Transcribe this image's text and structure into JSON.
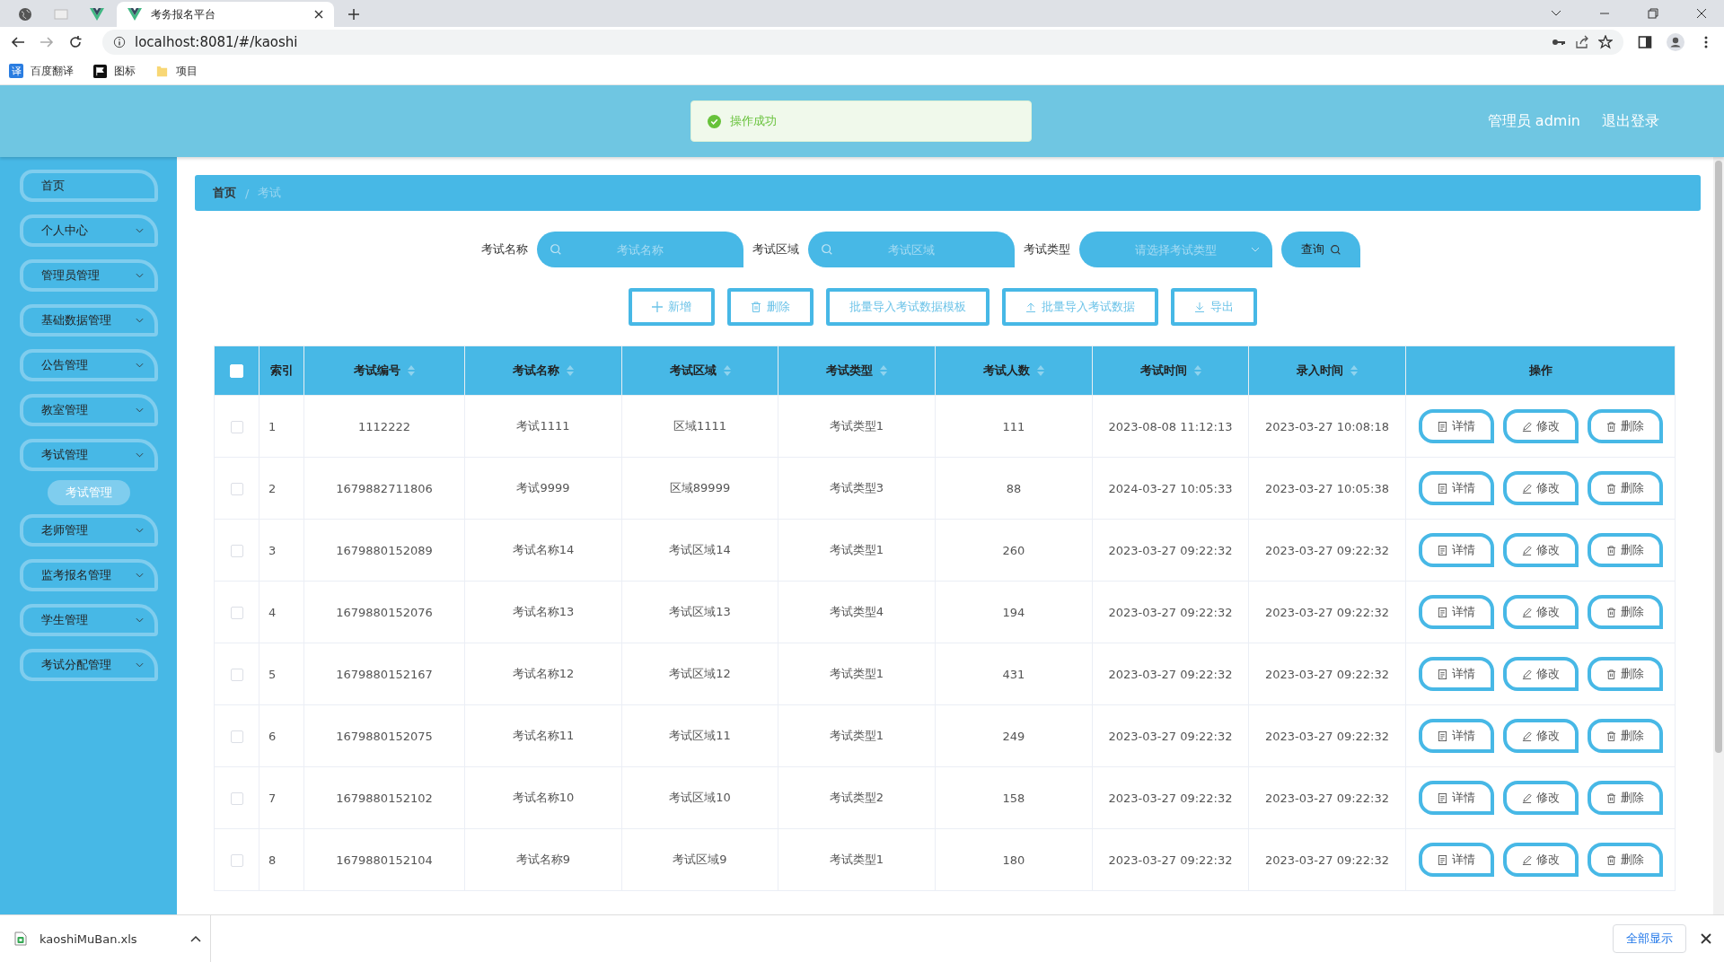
{
  "browser": {
    "tabs": [
      {
        "kind": "globe",
        "selected": false
      },
      {
        "kind": "blank",
        "selected": false
      },
      {
        "kind": "vue",
        "selected": false
      },
      {
        "kind": "vue",
        "title": "考务报名平台",
        "selected": true
      }
    ],
    "address": "localhost:8081/#/kaoshi",
    "bookmarks": [
      {
        "kind": "translate",
        "label": "百度翻译",
        "badge": "译"
      },
      {
        "kind": "flag",
        "label": "图标"
      },
      {
        "kind": "folder",
        "label": "项目"
      }
    ]
  },
  "header": {
    "toast": "操作成功",
    "user": "管理员 admin",
    "logout": "退出登录"
  },
  "sidebar": {
    "items": [
      {
        "label": "首页",
        "kind": "link"
      },
      {
        "label": "个人中心",
        "kind": "menu"
      },
      {
        "label": "管理员管理",
        "kind": "menu"
      },
      {
        "label": "基础数据管理",
        "kind": "menu"
      },
      {
        "label": "公告管理",
        "kind": "menu"
      },
      {
        "label": "教室管理",
        "kind": "menu"
      },
      {
        "label": "考试管理",
        "kind": "menu",
        "children": [
          {
            "label": "考试管理",
            "selected": true
          }
        ]
      },
      {
        "label": "老师管理",
        "kind": "menu"
      },
      {
        "label": "监考报名管理",
        "kind": "menu"
      },
      {
        "label": "学生管理",
        "kind": "menu"
      },
      {
        "label": "考试分配管理",
        "kind": "menu"
      }
    ]
  },
  "breadcrumb": [
    "首页",
    "考试"
  ],
  "breadcrumb_separator": "/",
  "filters": [
    {
      "label": "考试名称",
      "kind": "text",
      "placeholder": "考试名称"
    },
    {
      "label": "考试区域",
      "kind": "text",
      "placeholder": "考试区域"
    },
    {
      "label": "考试类型",
      "kind": "select",
      "placeholder": "请选择考试类型"
    }
  ],
  "search_button": "查询",
  "actions": [
    {
      "kind": "add",
      "label": "新增"
    },
    {
      "kind": "delete",
      "label": "删除"
    },
    {
      "kind": "none",
      "label": "批量导入考试数据模板"
    },
    {
      "kind": "upload",
      "label": "批量导入考试数据"
    },
    {
      "kind": "download",
      "label": "导出"
    }
  ],
  "table": {
    "columns": [
      {
        "label": "索引",
        "sortable": false
      },
      {
        "label": "考试编号",
        "sortable": true
      },
      {
        "label": "考试名称",
        "sortable": true
      },
      {
        "label": "考试区域",
        "sortable": true
      },
      {
        "label": "考试类型",
        "sortable": true
      },
      {
        "label": "考试人数",
        "sortable": true
      },
      {
        "label": "考试时间",
        "sortable": true
      },
      {
        "label": "录入时间",
        "sortable": true
      },
      {
        "label": "操作",
        "sortable": false
      }
    ],
    "header_checked": false,
    "rows": [
      {
        "checked": false,
        "cells": [
          "1",
          "1112222",
          "考试1111",
          "区域1111",
          "考试类型1",
          "111",
          "2023-08-08 11:12:13",
          "2023-03-27 10:08:18"
        ],
        "actions": [
          {
            "kind": "detail",
            "label": "详情"
          },
          {
            "kind": "edit",
            "label": "修改"
          },
          {
            "kind": "delete",
            "label": "删除"
          }
        ]
      },
      {
        "checked": false,
        "cells": [
          "2",
          "1679882711806",
          "考试9999",
          "区域89999",
          "考试类型3",
          "88",
          "2024-03-27 10:05:33",
          "2023-03-27 10:05:38"
        ],
        "actions": [
          {
            "kind": "detail",
            "label": "详情"
          },
          {
            "kind": "edit",
            "label": "修改"
          },
          {
            "kind": "delete",
            "label": "删除"
          }
        ]
      },
      {
        "checked": false,
        "cells": [
          "3",
          "1679880152089",
          "考试名称14",
          "考试区域14",
          "考试类型1",
          "260",
          "2023-03-27 09:22:32",
          "2023-03-27 09:22:32"
        ],
        "actions": [
          {
            "kind": "detail",
            "label": "详情"
          },
          {
            "kind": "edit",
            "label": "修改"
          },
          {
            "kind": "delete",
            "label": "删除"
          }
        ]
      },
      {
        "checked": false,
        "cells": [
          "4",
          "1679880152076",
          "考试名称13",
          "考试区域13",
          "考试类型4",
          "194",
          "2023-03-27 09:22:32",
          "2023-03-27 09:22:32"
        ],
        "actions": [
          {
            "kind": "detail",
            "label": "详情"
          },
          {
            "kind": "edit",
            "label": "修改"
          },
          {
            "kind": "delete",
            "label": "删除"
          }
        ]
      },
      {
        "checked": false,
        "cells": [
          "5",
          "1679880152167",
          "考试名称12",
          "考试区域12",
          "考试类型1",
          "431",
          "2023-03-27 09:22:32",
          "2023-03-27 09:22:32"
        ],
        "actions": [
          {
            "kind": "detail",
            "label": "详情"
          },
          {
            "kind": "edit",
            "label": "修改"
          },
          {
            "kind": "delete",
            "label": "删除"
          }
        ]
      },
      {
        "checked": false,
        "cells": [
          "6",
          "1679880152075",
          "考试名称11",
          "考试区域11",
          "考试类型1",
          "249",
          "2023-03-27 09:22:32",
          "2023-03-27 09:22:32"
        ],
        "actions": [
          {
            "kind": "detail",
            "label": "详情"
          },
          {
            "kind": "edit",
            "label": "修改"
          },
          {
            "kind": "delete",
            "label": "删除"
          }
        ]
      },
      {
        "checked": false,
        "cells": [
          "7",
          "1679880152102",
          "考试名称10",
          "考试区域10",
          "考试类型2",
          "158",
          "2023-03-27 09:22:32",
          "2023-03-27 09:22:32"
        ],
        "actions": [
          {
            "kind": "detail",
            "label": "详情"
          },
          {
            "kind": "edit",
            "label": "修改"
          },
          {
            "kind": "delete",
            "label": "删除"
          }
        ]
      },
      {
        "checked": false,
        "cells": [
          "8",
          "1679880152104",
          "考试名称9",
          "考试区域9",
          "考试类型1",
          "180",
          "2023-03-27 09:22:32",
          "2023-03-27 09:22:32"
        ],
        "actions": [
          {
            "kind": "detail",
            "label": "详情"
          },
          {
            "kind": "edit",
            "label": "修改"
          },
          {
            "kind": "delete",
            "label": "删除"
          }
        ]
      }
    ]
  },
  "download_bar": {
    "file": "kaoshiMuBan.xls",
    "show_all": "全部显示"
  }
}
